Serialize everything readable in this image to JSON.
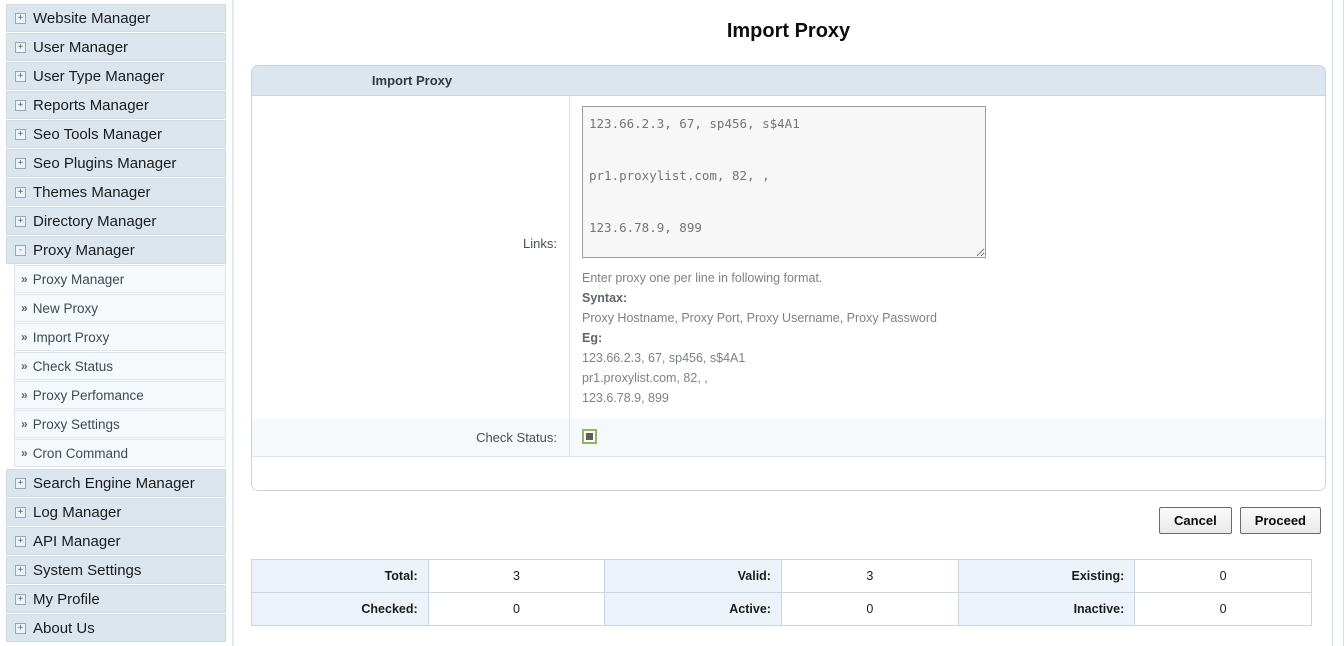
{
  "sidebar": {
    "groups": [
      {
        "label": "Website Manager",
        "toggle": "+",
        "expanded": false
      },
      {
        "label": "User Manager",
        "toggle": "+",
        "expanded": false
      },
      {
        "label": "User Type Manager",
        "toggle": "+",
        "expanded": false
      },
      {
        "label": "Reports Manager",
        "toggle": "+",
        "expanded": false
      },
      {
        "label": "Seo Tools Manager",
        "toggle": "+",
        "expanded": false
      },
      {
        "label": "Seo Plugins Manager",
        "toggle": "+",
        "expanded": false
      },
      {
        "label": "Themes Manager",
        "toggle": "+",
        "expanded": false
      },
      {
        "label": "Directory Manager",
        "toggle": "+",
        "expanded": false
      },
      {
        "label": "Proxy Manager",
        "toggle": "-",
        "expanded": true
      },
      {
        "label": "Search Engine Manager",
        "toggle": "+",
        "expanded": false
      },
      {
        "label": "Log Manager",
        "toggle": "+",
        "expanded": false
      },
      {
        "label": "API Manager",
        "toggle": "+",
        "expanded": false
      },
      {
        "label": "System Settings",
        "toggle": "+",
        "expanded": false
      },
      {
        "label": "My Profile",
        "toggle": "+",
        "expanded": false
      },
      {
        "label": "About Us",
        "toggle": "+",
        "expanded": false
      }
    ],
    "proxy_submenu": {
      "chevron": "»",
      "items": [
        {
          "label": "Proxy Manager"
        },
        {
          "label": "New Proxy"
        },
        {
          "label": "Import Proxy"
        },
        {
          "label": "Check Status"
        },
        {
          "label": "Proxy Perfomance"
        },
        {
          "label": "Proxy Settings"
        },
        {
          "label": "Cron Command"
        }
      ]
    }
  },
  "main": {
    "page_title": "Import Proxy",
    "panel_legend": "Import Proxy",
    "links": {
      "label": "Links:",
      "placeholder": "123.66.2.3, 67, sp456, s$4A1\n\npr1.proxylist.com, 82, ,\n\n123.6.78.9, 899",
      "value": "",
      "help_intro": "Enter proxy one per line in following format.",
      "syntax_label": "Syntax:",
      "syntax_value": "Proxy Hostname, Proxy Port, Proxy Username, Proxy Password",
      "eg_label": "Eg:",
      "eg_lines": [
        "123.66.2.3, 67, sp456, s$4A1",
        "pr1.proxylist.com, 82, ,",
        "123.6.78.9, 899"
      ]
    },
    "check_status": {
      "label": "Check Status:",
      "icon": "checkbox-checked-icon",
      "checked": true,
      "accent_color": "#8cb564"
    },
    "buttons": {
      "cancel": "Cancel",
      "proceed": "Proceed"
    }
  },
  "stats": {
    "rows": [
      [
        {
          "key": "Total:",
          "value": "3"
        },
        {
          "key": "Valid:",
          "value": "3"
        },
        {
          "key": "Existing:",
          "value": "0"
        }
      ],
      [
        {
          "key": "Checked:",
          "value": "0"
        },
        {
          "key": "Active:",
          "value": "0"
        },
        {
          "key": "Inactive:",
          "value": "0"
        }
      ]
    ]
  }
}
